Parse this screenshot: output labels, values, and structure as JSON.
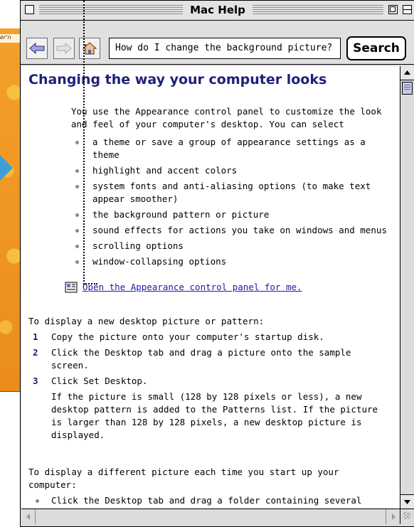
{
  "desktop": {
    "partial_label": "er'n"
  },
  "window": {
    "title": "Mac Help"
  },
  "toolbar": {
    "search_value": "How do I change the background picture?",
    "search_button_label": "Search"
  },
  "content": {
    "heading": "Changing the way your computer looks",
    "intro": "You use the Appearance control panel to customize the look and feel of your computer's desktop. You can select",
    "bullets": [
      "a theme or save a group of appearance settings as a theme",
      "highlight and accent colors",
      "system fonts and anti-aliasing options (to make text appear smoother)",
      "the background pattern or picture",
      "sound effects for actions you take on windows and menus",
      "scrolling options",
      "window-collapsing options"
    ],
    "link_text": "Open the Appearance control panel for me.",
    "steps_intro": "To display a new desktop picture or pattern:",
    "steps": [
      {
        "num": "1",
        "text": "Copy the picture onto your computer's startup disk."
      },
      {
        "num": "2",
        "text": "Click the Desktop tab and drag a picture onto the sample screen."
      },
      {
        "num": "3",
        "text": "Click Set Desktop."
      }
    ],
    "step_note": "If the picture is small (128 by 128 pixels or less), a new desktop pattern is added to the Patterns list. If the picture is larger than 128 by 128 pixels, a new desktop picture is displayed.",
    "para2": "To display a different picture each time you start up your computer:",
    "bullet2": "Click the Desktop tab and drag a folder containing several"
  },
  "colors": {
    "heading": "#20207a",
    "link": "#1a1aa8",
    "desktop_accent": "#eb8c1c"
  }
}
